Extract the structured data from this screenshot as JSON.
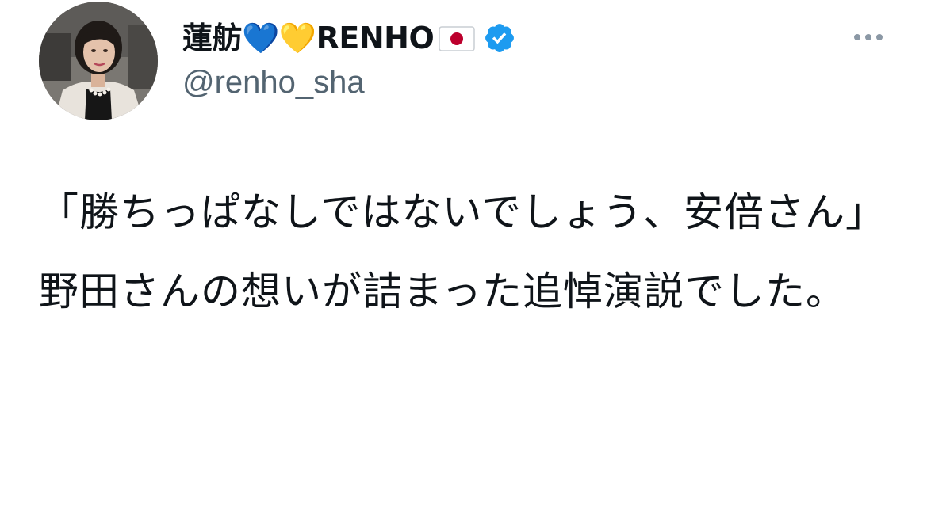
{
  "tweet": {
    "author": {
      "display_name": "蓮舫💙💛RENHO",
      "handle": "@renho_sha",
      "avatar_alt": "avatar",
      "verified": true,
      "flag_icon": "japan-flag-icon",
      "verified_icon": "verified-badge-icon"
    },
    "menu_icon": "more-options-icon",
    "paragraphs": [
      "「勝ちっぱなしではないでしょう、安倍さん」",
      "野田さんの想いが詰まった追悼演説でした。"
    ]
  },
  "colors": {
    "text": "#0f1419",
    "secondary": "#536471",
    "verified": "#1d9bf0",
    "flag_red": "#bc002d",
    "menu_dots": "#8b98a5"
  }
}
